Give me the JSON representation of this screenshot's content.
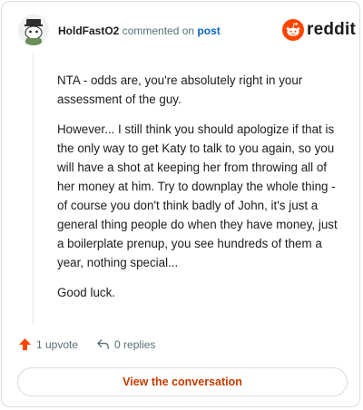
{
  "header": {
    "username": "HoldFastO2",
    "action_text": "commented on",
    "post_link": "post",
    "logo_text": "reddit"
  },
  "comment": {
    "paragraphs": [
      "NTA - odds are, you're absolutely right in your assessment of the guy.",
      "However... I still think you should apologize if that is the only way to get Katy to talk to you again, so you will have a shot at keeping her from throwing all of her money at him. Try to downplay the whole thing - of course you don't think badly of John, it's just a general thing people do when they have money, just a boilerplate prenup, you see hundreds of them a year, nothing special...",
      "Good luck."
    ]
  },
  "actions": {
    "upvotes": "1 upvote",
    "replies": "0 replies"
  },
  "cta": {
    "label": "View the conversation"
  },
  "colors": {
    "upvote": "#ff4500",
    "link": "#0a66c2",
    "cta": "#c23b00",
    "text": "#1c1c1c",
    "muted": "#576f76"
  },
  "icons": [
    "avatar",
    "reddit-logo-icon",
    "upvote-arrow-icon",
    "reply-arrow-icon"
  ]
}
